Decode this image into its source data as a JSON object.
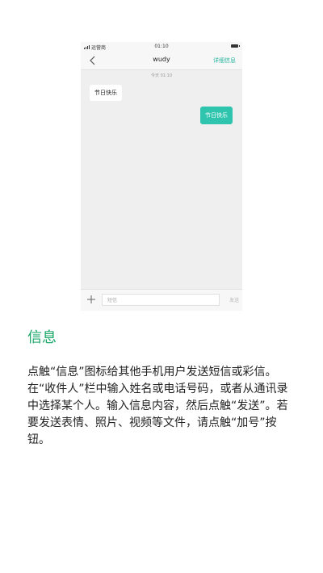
{
  "statusbar": {
    "carrier": "运营商",
    "time": "01:10"
  },
  "navbar": {
    "title": "wudy",
    "details_label": "详细信息"
  },
  "chat": {
    "timestamp": "今天 01:10",
    "incoming": "节日快乐",
    "outgoing": "节日快乐"
  },
  "composer": {
    "placeholder": "短信",
    "send_label": "发送"
  },
  "info": {
    "heading": "信息",
    "description": "点触“信息”图标给其他手机用户发送短信或彩信。在“收件人”栏中输入姓名或电话号码，或者从通讯录中选择某个人。输入信息内容，然后点触“发送”。若要发送表情、照片、视频等文件，请点触“加号”按钮。"
  },
  "colors": {
    "accent": "#2ec4ae",
    "heading": "#1aa86a"
  },
  "icons": [
    "signal-icon",
    "battery-icon",
    "back-chevron-icon",
    "plus-icon"
  ]
}
